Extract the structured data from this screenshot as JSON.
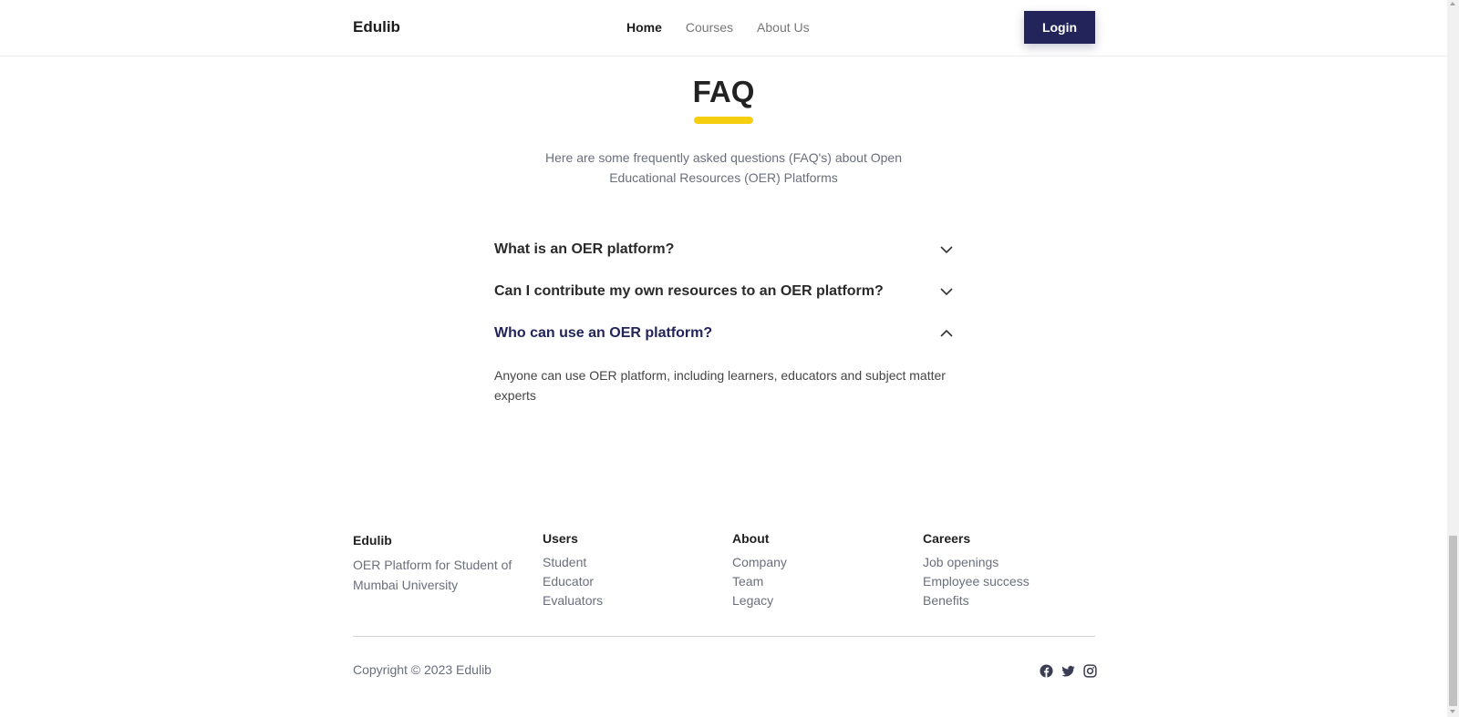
{
  "header": {
    "brand": "Edulib",
    "nav": [
      {
        "label": "Home",
        "active": true
      },
      {
        "label": "Courses",
        "active": false
      },
      {
        "label": "About Us",
        "active": false
      }
    ],
    "login_label": "Login"
  },
  "faq": {
    "title": "FAQ",
    "subtitle": "Here are some frequently asked questions (FAQ's) about Open Educational Resources (OER) Platforms",
    "items": [
      {
        "question": "What is an OER platform?",
        "expanded": false,
        "icon": "chevron-down-icon"
      },
      {
        "question": "Can I contribute my own resources to an OER platform?",
        "expanded": false,
        "icon": "chevron-down-icon"
      },
      {
        "question": "Who can use an OER platform?",
        "expanded": true,
        "icon": "chevron-up-icon",
        "answer": "Anyone can use OER platform, including learners, educators and subject matter experts"
      }
    ]
  },
  "footer": {
    "brand": "Edulib",
    "description": "OER Platform for Student of Mumbai University",
    "columns": [
      {
        "heading": "Users",
        "links": [
          "Student",
          "Educator",
          "Evaluators"
        ]
      },
      {
        "heading": "About",
        "links": [
          "Company",
          "Team",
          "Legacy"
        ]
      },
      {
        "heading": "Careers",
        "links": [
          "Job openings",
          "Employee success",
          "Benefits"
        ]
      }
    ],
    "copyright": "Copyright © 2023 Edulib",
    "socials": [
      "facebook-icon",
      "twitter-icon",
      "instagram-icon"
    ]
  },
  "colors": {
    "accent": "#23245a",
    "underline": "#f5cf0f",
    "muted_text": "#6a6f7c"
  }
}
